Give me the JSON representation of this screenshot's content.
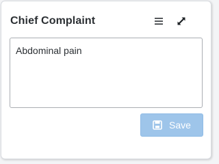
{
  "panel": {
    "title": "Chief Complaint",
    "value": "Abdominal pain"
  },
  "toolbar": {
    "menu_icon": "menu-icon",
    "expand_icon": "expand-icon"
  },
  "actions": {
    "save_label": "Save",
    "save_icon": "floppy-disk-icon",
    "save_enabled": false
  },
  "colors": {
    "save_button_bg": "#9ec5ea",
    "title_text": "#2b2f33"
  }
}
